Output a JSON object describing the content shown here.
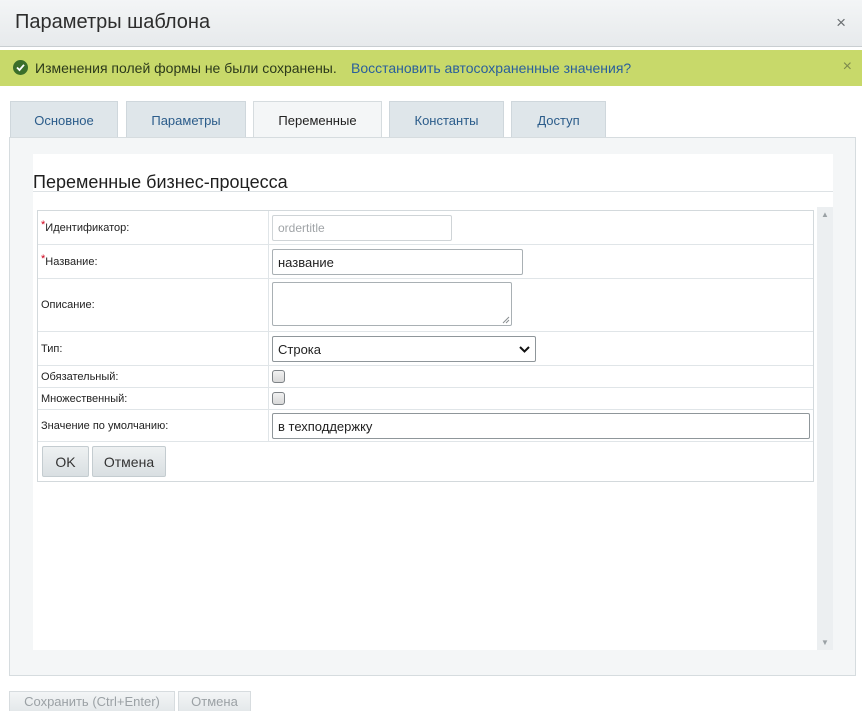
{
  "window": {
    "title": "Параметры шаблона",
    "close_glyph": "×"
  },
  "notice": {
    "message": "Изменения полей формы не были сохранены.",
    "link": "Восстановить автосохраненные значения?",
    "close_glyph": "×"
  },
  "tabs": [
    {
      "label": "Основное",
      "active": false
    },
    {
      "label": "Параметры",
      "active": false
    },
    {
      "label": "Переменные",
      "active": true
    },
    {
      "label": "Константы",
      "active": false
    },
    {
      "label": "Доступ",
      "active": false
    }
  ],
  "section": {
    "title": "Переменные бизнес-процесса"
  },
  "form": {
    "required_mark": "*",
    "identifier": {
      "label": "Идентификатор:",
      "placeholder": "ordertitle"
    },
    "name": {
      "label": "Название:",
      "value": "название"
    },
    "description": {
      "label": "Описание:",
      "value": ""
    },
    "type": {
      "label": "Тип:",
      "selected": "Строка"
    },
    "required": {
      "label": "Обязательный:",
      "checked": false
    },
    "multiple": {
      "label": "Множественный:",
      "checked": false
    },
    "default": {
      "label": "Значение по умолчанию:",
      "value": "в техподдержку"
    },
    "ok_label": "OK",
    "cancel_label": "Отмена"
  },
  "footer": {
    "save_label": "Сохранить (Ctrl+Enter)",
    "cancel_label": "Отмена"
  },
  "colors": {
    "notice_bg": "#c8d96a",
    "link": "#2a5f9c",
    "required_mark": "#d0021b"
  }
}
